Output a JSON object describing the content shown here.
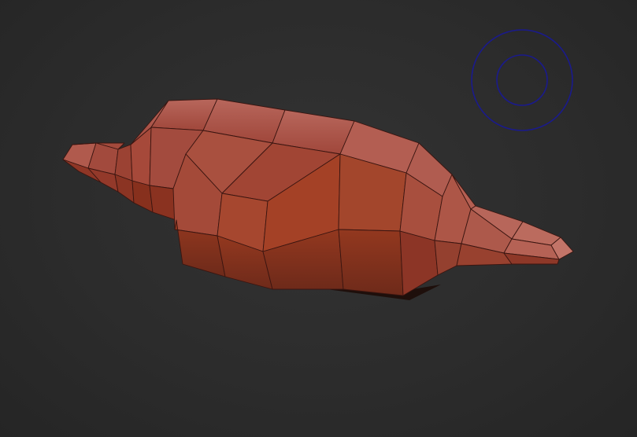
{
  "viewport": {
    "background_color": "#2b2b2b",
    "mesh": {
      "shape": "low-poly elongated sculpt, two spindle ends",
      "base_color": "#a8493a",
      "edge_color": "#3a1510"
    },
    "brush_cursor": {
      "icon": "brush-radius-icon",
      "color": "#1a1a8c"
    }
  }
}
